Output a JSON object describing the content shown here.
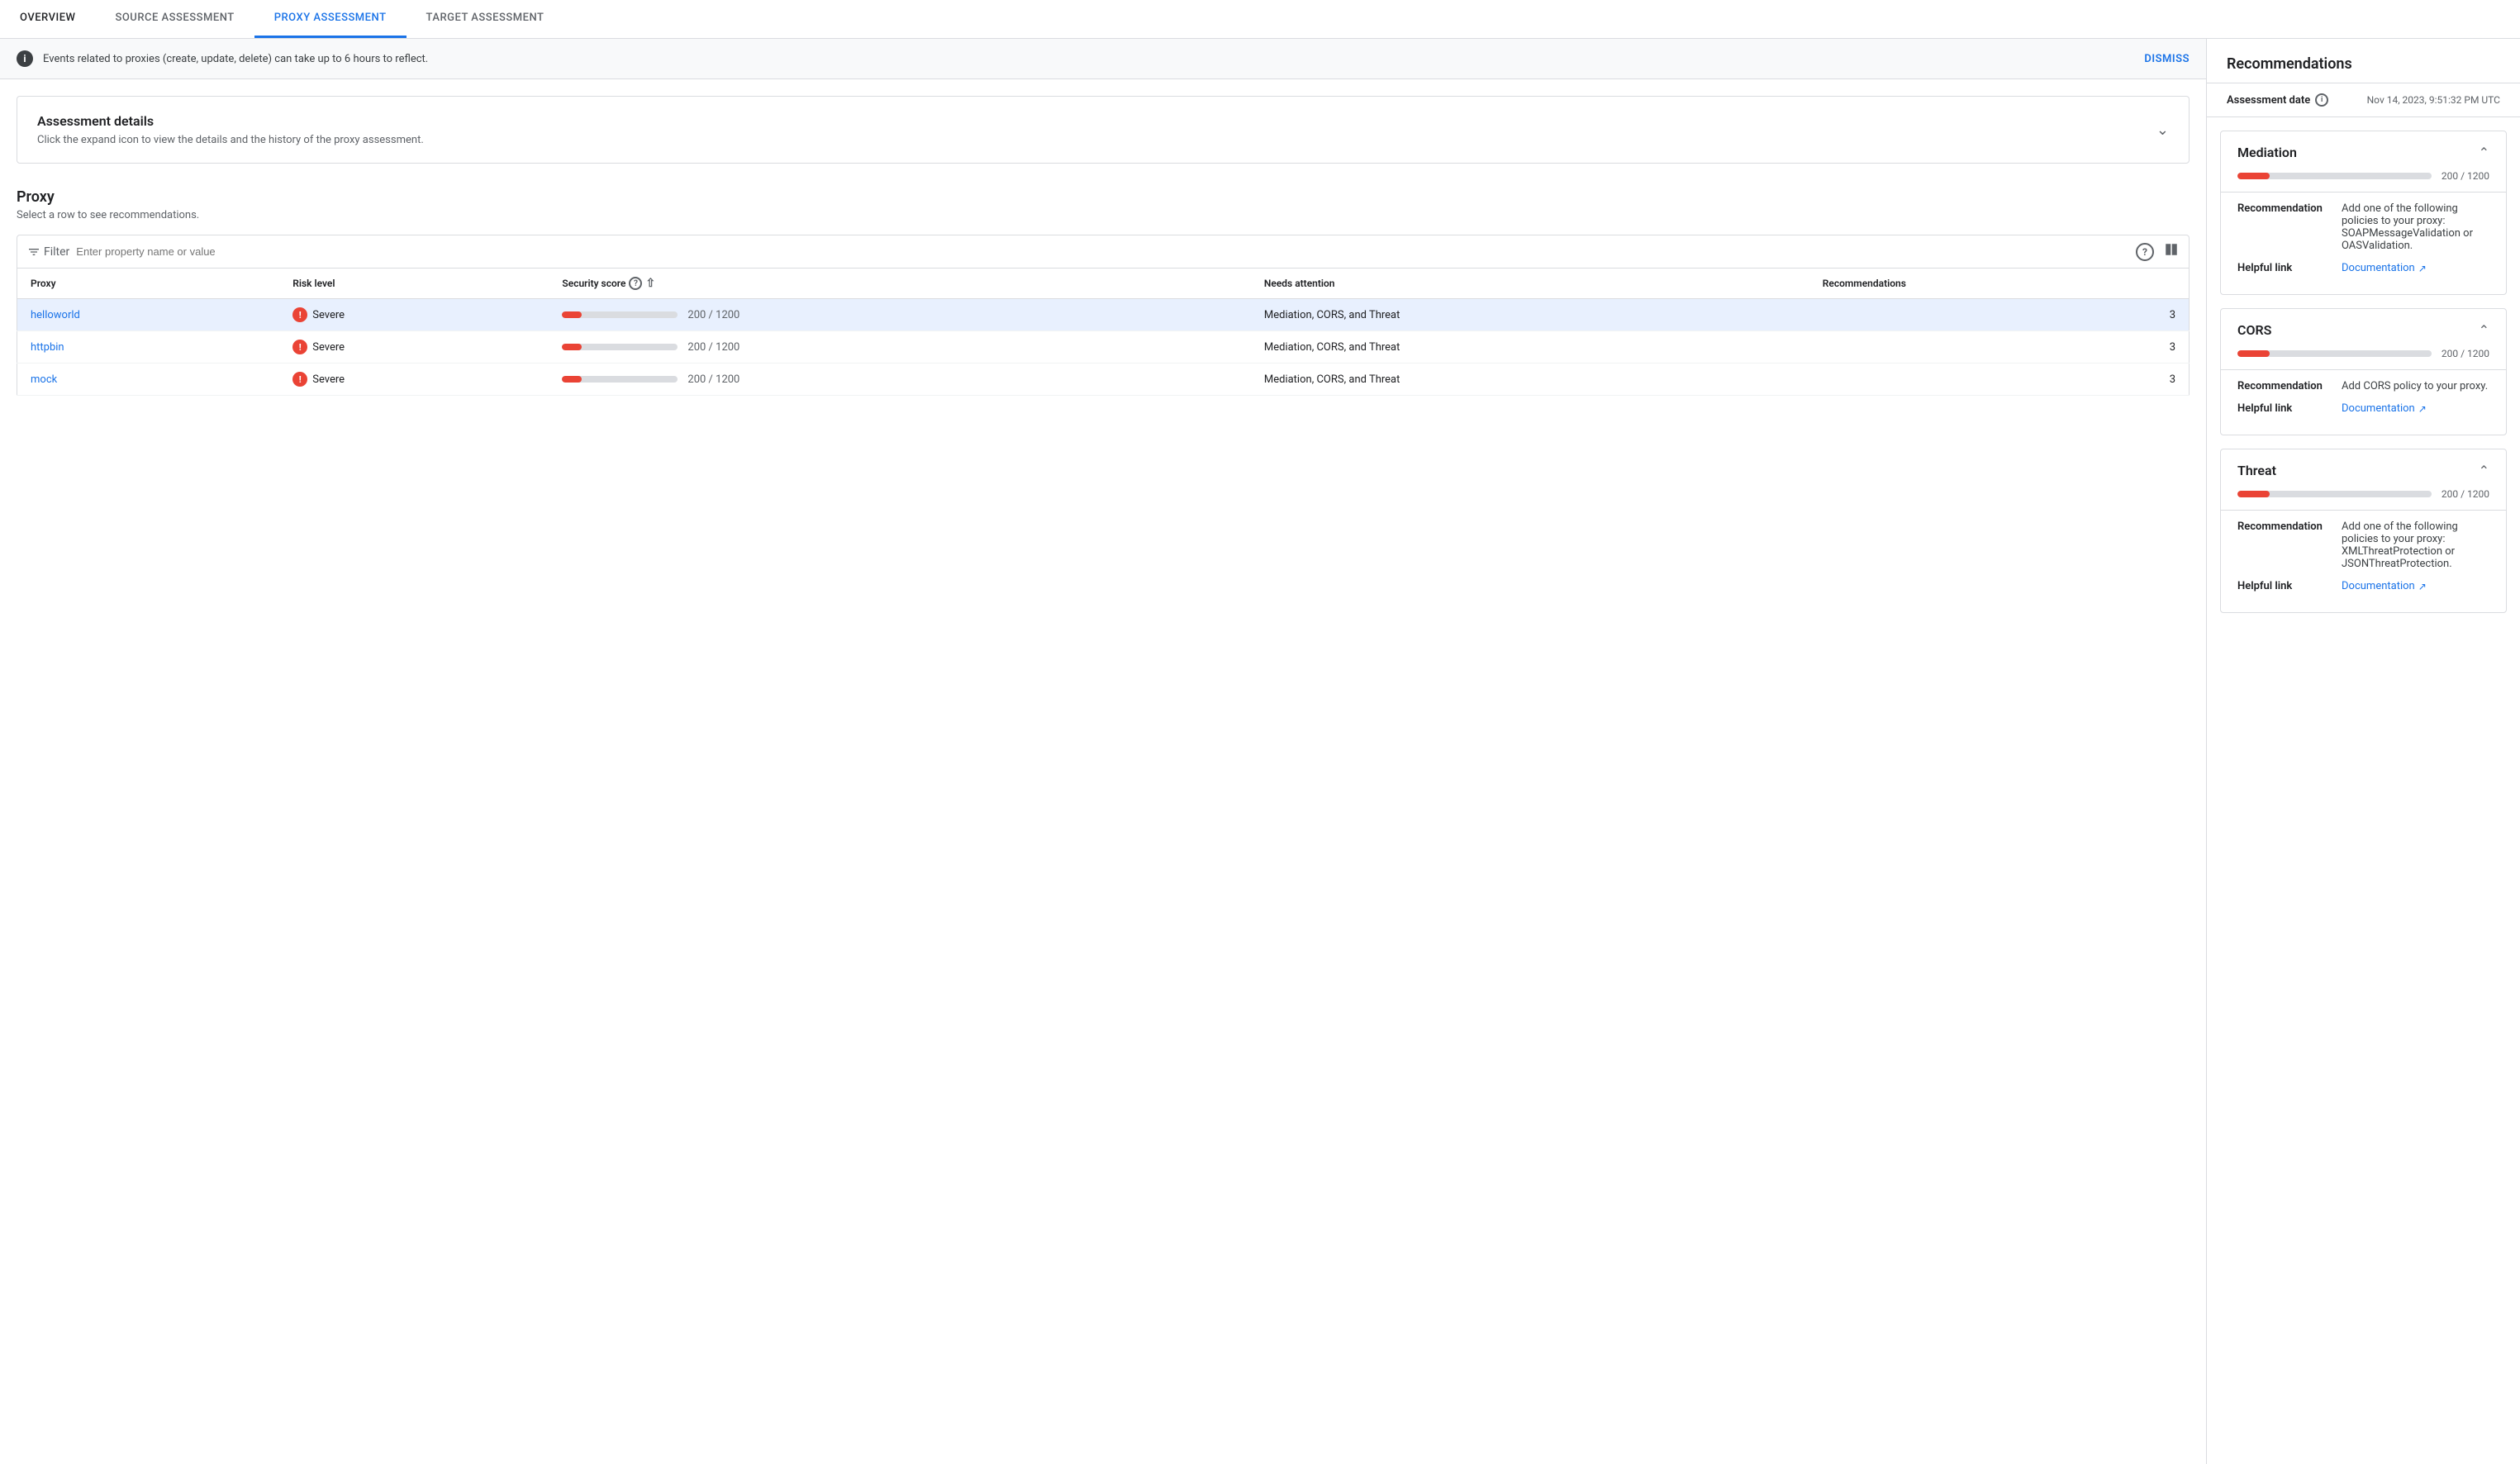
{
  "tabs": [
    {
      "id": "overview",
      "label": "OVERVIEW",
      "active": false
    },
    {
      "id": "source-assessment",
      "label": "SOURCE ASSESSMENT",
      "active": false
    },
    {
      "id": "proxy-assessment",
      "label": "PROXY ASSESSMENT",
      "active": true
    },
    {
      "id": "target-assessment",
      "label": "TARGET ASSESSMENT",
      "active": false
    }
  ],
  "banner": {
    "text": "Events related to proxies (create, update, delete) can take up to 6 hours to reflect.",
    "dismiss_label": "DISMISS"
  },
  "assessment_details": {
    "title": "Assessment details",
    "subtitle": "Click the expand icon to view the details and the history of the proxy assessment."
  },
  "proxy_section": {
    "title": "Proxy",
    "subtitle": "Select a row to see recommendations.",
    "filter_placeholder": "Enter property name or value"
  },
  "table": {
    "columns": [
      {
        "id": "proxy",
        "label": "Proxy"
      },
      {
        "id": "risk_level",
        "label": "Risk level"
      },
      {
        "id": "security_score",
        "label": "Security score"
      },
      {
        "id": "needs_attention",
        "label": "Needs attention"
      },
      {
        "id": "recommendations",
        "label": "Recommendations"
      }
    ],
    "rows": [
      {
        "proxy": "helloworld",
        "risk_level": "Severe",
        "score_value": 200,
        "score_max": 1200,
        "score_display": "200 / 1200",
        "score_percent": 16.7,
        "needs_attention": "Mediation, CORS, and Threat",
        "recommendations": 3,
        "selected": true
      },
      {
        "proxy": "httpbin",
        "risk_level": "Severe",
        "score_value": 200,
        "score_max": 1200,
        "score_display": "200 / 1200",
        "score_percent": 16.7,
        "needs_attention": "Mediation, CORS, and Threat",
        "recommendations": 3,
        "selected": false
      },
      {
        "proxy": "mock",
        "risk_level": "Severe",
        "score_value": 200,
        "score_max": 1200,
        "score_display": "200 / 1200",
        "score_percent": 16.7,
        "needs_attention": "Mediation, CORS, and Threat",
        "recommendations": 3,
        "selected": false
      }
    ]
  },
  "right_panel": {
    "title": "Recommendations",
    "assessment_date_label": "Assessment date",
    "assessment_date_value": "Nov 14, 2023, 9:51:32 PM UTC",
    "cards": [
      {
        "id": "mediation",
        "title": "Mediation",
        "score_display": "200 / 1200",
        "score_percent": 16.7,
        "recommendation": "Add one of the following policies to your proxy: SOAPMessageValidation or OASValidation.",
        "helpful_link_text": "Documentation",
        "helpful_link_url": "#"
      },
      {
        "id": "cors",
        "title": "CORS",
        "score_display": "200 / 1200",
        "score_percent": 16.7,
        "recommendation": "Add CORS policy to your proxy.",
        "helpful_link_text": "Documentation",
        "helpful_link_url": "#"
      },
      {
        "id": "threat",
        "title": "Threat",
        "score_display": "200 / 1200",
        "score_percent": 16.7,
        "recommendation": "Add one of the following policies to your proxy: XMLThreatProtection or JSONThreatProtection.",
        "helpful_link_text": "Documentation",
        "helpful_link_url": "#"
      }
    ],
    "recommendation_label": "Recommendation",
    "helpful_link_label": "Helpful link"
  }
}
